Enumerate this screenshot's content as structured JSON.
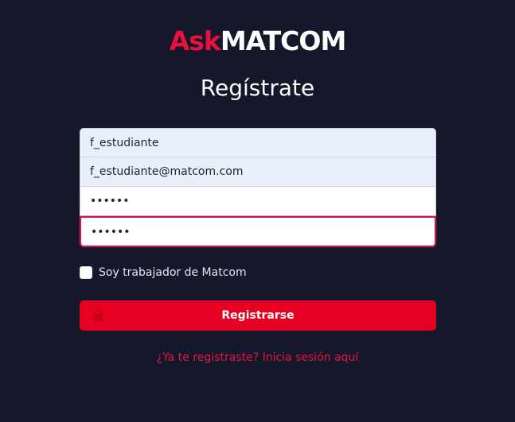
{
  "logo": {
    "ask": "Ask",
    "matcom": "MATCOM"
  },
  "title": "Regístrate",
  "form": {
    "username": {
      "value": "f_estudiante"
    },
    "email": {
      "value": "f_estudiante@matcom.com"
    },
    "password": {
      "value": "••••••"
    },
    "confirm_password": {
      "value": "••••••"
    }
  },
  "worker_checkbox": {
    "label": "Soy trabajador de Matcom",
    "checked": false
  },
  "submit": {
    "label": "Registrarse",
    "icon": "lock-icon"
  },
  "login_link": "¿Ya te registraste? Inicia sesión aquí",
  "colors": {
    "background": "#15172b",
    "accent": "#e60022",
    "link": "#e0183d",
    "focus_border": "#c9174a"
  }
}
